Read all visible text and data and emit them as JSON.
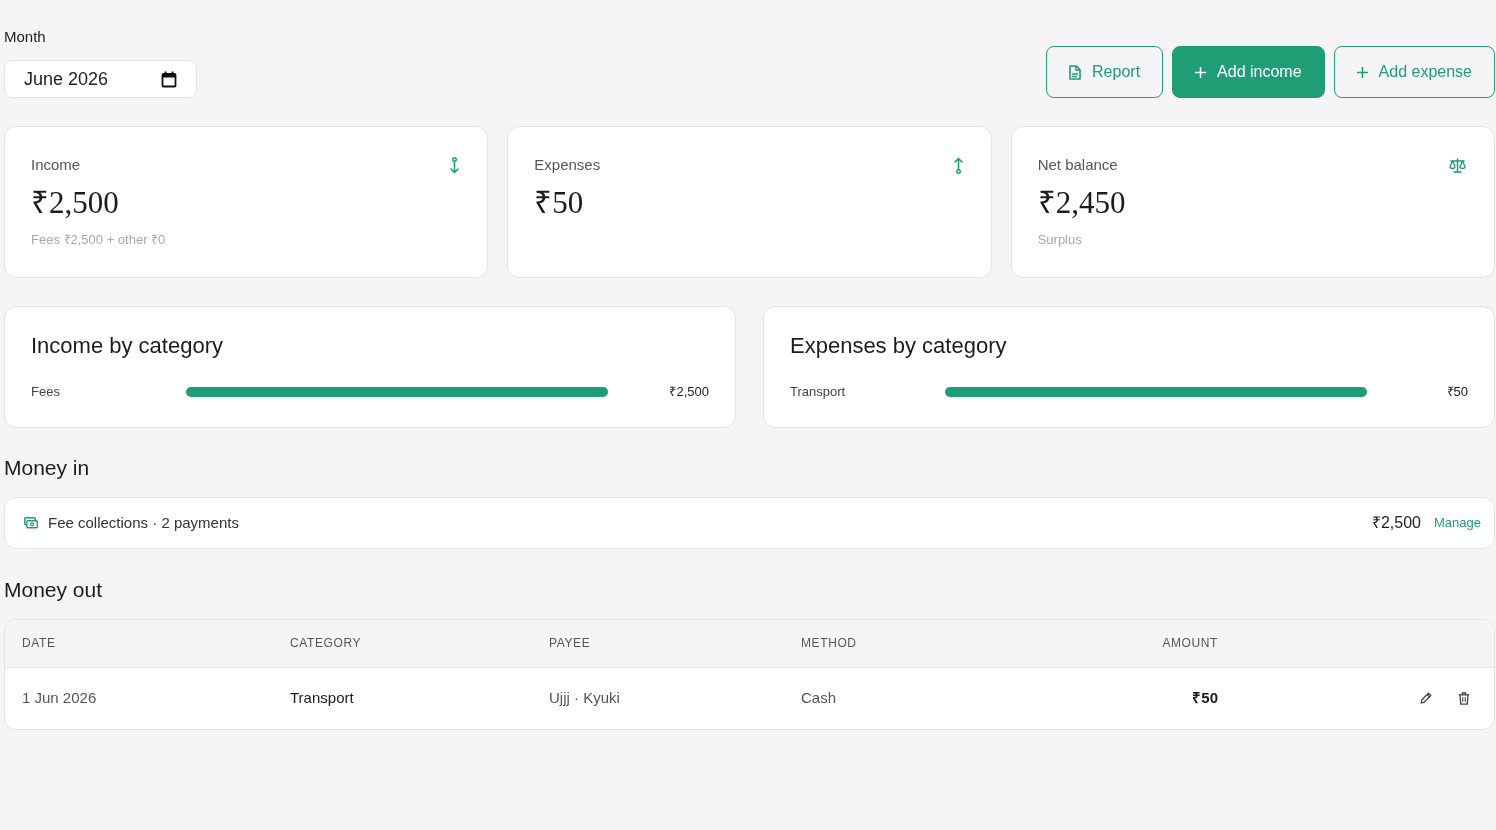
{
  "month": {
    "label": "Month",
    "value": "June 2026"
  },
  "actions": [
    {
      "kind": "report",
      "label": "Report"
    },
    {
      "kind": "filled",
      "label": "Add income"
    },
    {
      "kind": "outline",
      "label": "Add expense"
    }
  ],
  "stats": [
    {
      "kind": "income",
      "label": "Income",
      "amount": "₹2,500",
      "note": "Fees ₹2,500 + other ₹0"
    },
    {
      "kind": "expense",
      "label": "Expenses",
      "amount": "₹50"
    },
    {
      "kind": "balance",
      "label": "Net balance",
      "amount": "₹2,450",
      "note": "Surplus"
    }
  ],
  "breakdowns": [
    {
      "title": "Income by category",
      "rows": [
        {
          "name": "Fees",
          "level": 1,
          "amount": "₹2,500"
        }
      ]
    },
    {
      "title": "Expenses by category",
      "rows": [
        {
          "name": "Transport",
          "level": 1,
          "amount": "₹50"
        }
      ]
    }
  ],
  "money_in": {
    "heading": "Money in",
    "rows": [
      {
        "text": "Fee collections · 2 payments",
        "amount": "₹2,500",
        "link": "Manage"
      }
    ]
  },
  "money_out": {
    "heading": "Money out",
    "columns": [
      "DATE",
      "CATEGORY",
      "PAYEE",
      "METHOD",
      "AMOUNT"
    ],
    "rows": [
      {
        "cells": [
          "1 Jun 2026",
          "Transport",
          "Ujjj · Kyuki",
          "Cash",
          "₹50"
        ]
      }
    ]
  }
}
